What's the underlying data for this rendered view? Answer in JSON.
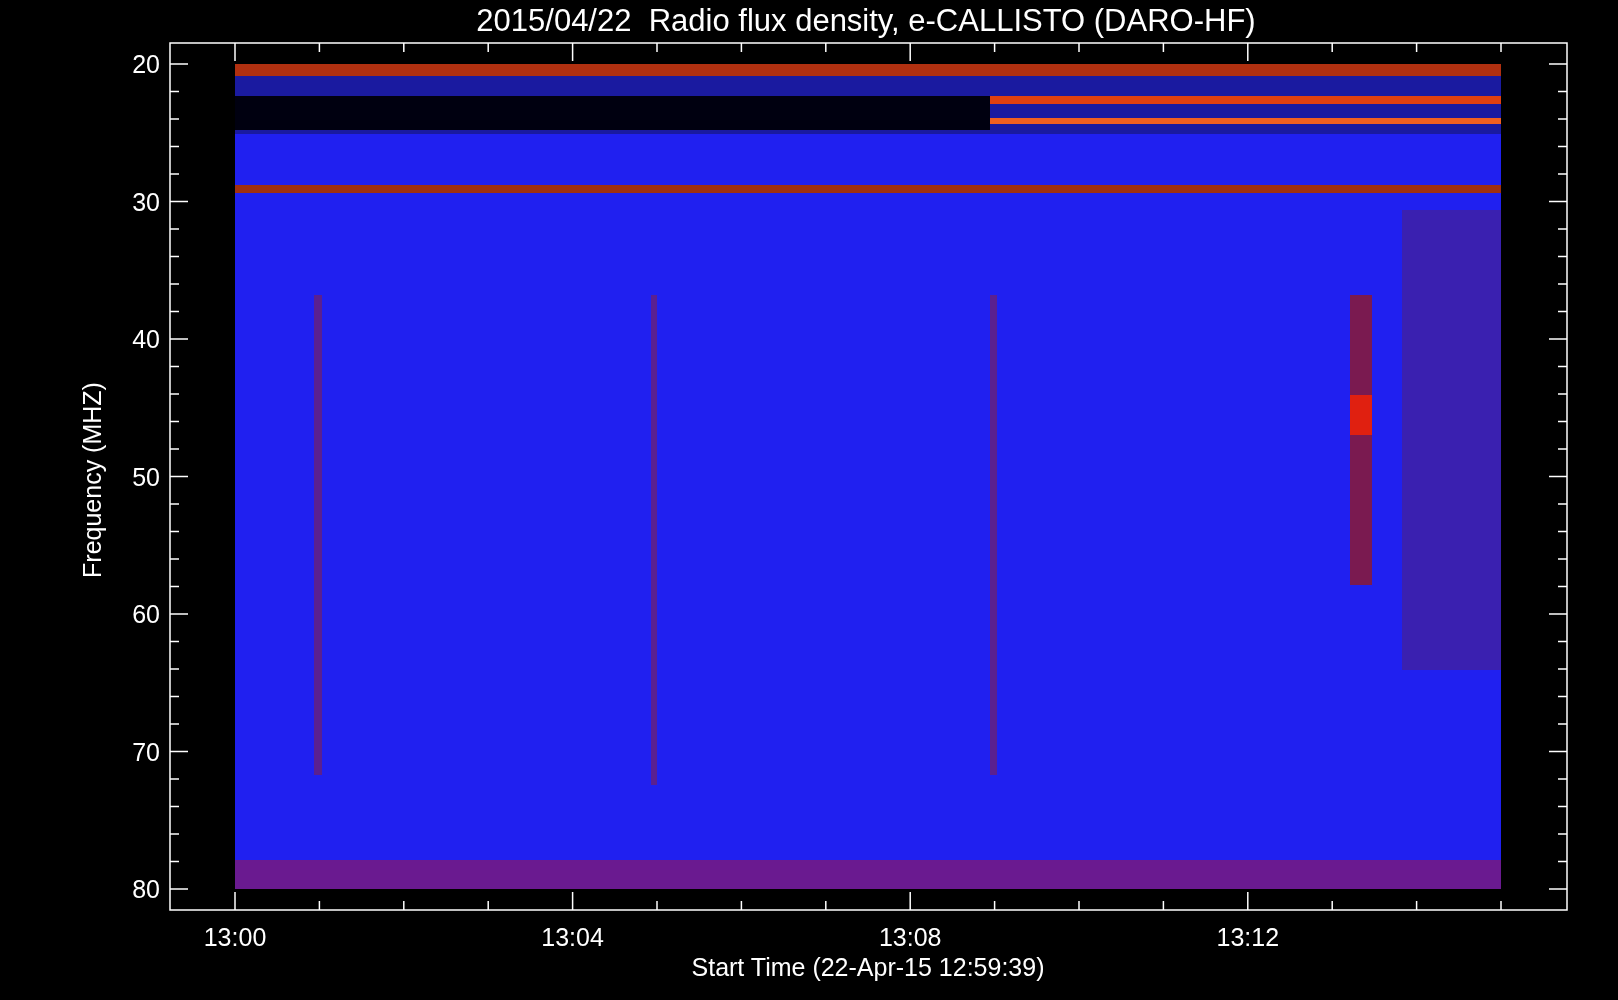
{
  "title": "2015/04/22  Radio flux density, e-CALLISTO (DARO-HF)",
  "y_axis": {
    "label": "Frequency (MHZ)",
    "ticks": [
      "20",
      "30",
      "40",
      "50",
      "60",
      "70",
      "80"
    ]
  },
  "x_axis": {
    "label": "Start Time (22-Apr-15 12:59:39)",
    "ticks": [
      "13:00",
      "13:04",
      "13:08",
      "13:12"
    ]
  }
}
